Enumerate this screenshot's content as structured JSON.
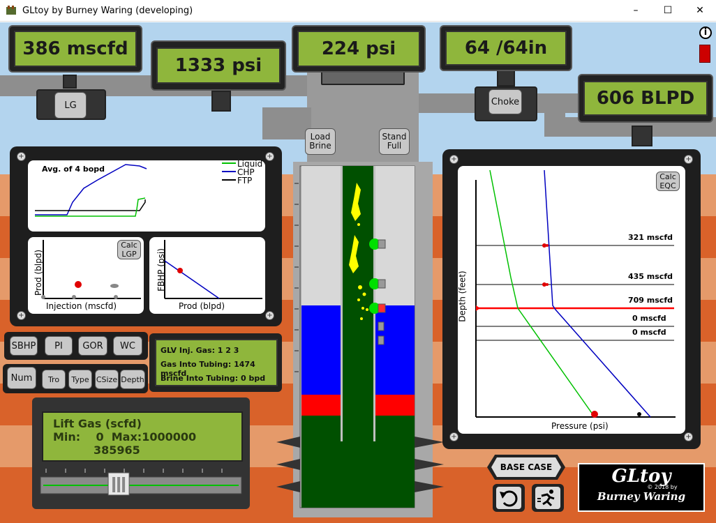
{
  "window": {
    "title": "GLtoy by Burney Waring (developing)",
    "min": "–",
    "max": "☐",
    "close": "✕"
  },
  "gauges": {
    "lift_gas": "386 mscfd",
    "casing_pressure": "1333 psi",
    "tubing_pressure": "224 psi",
    "choke": "64 /64in",
    "production": "606 BLPD"
  },
  "buttons": {
    "lg": "LG",
    "choke": "Choke",
    "load_brine": "Load\nBrine",
    "stand_full": "Stand\nFull",
    "calc_lgp": "Calc\nLGP",
    "calc_eqc": "Calc\nEQC",
    "sbhp": "SBHP",
    "pi": "PI",
    "gor": "GOR",
    "wc": "WC",
    "num": "Num",
    "tro": "Tro",
    "type": "Type",
    "csize": "CSize",
    "depth": "Depth",
    "base_case": "BASE CASE",
    "info": "i"
  },
  "trend": {
    "title": "Avg. of  4 bopd",
    "legend": [
      {
        "name": "Liquid",
        "color": "#00c000"
      },
      {
        "name": "CHP",
        "color": "#0000c0"
      },
      {
        "name": "FTP",
        "color": "#000000"
      }
    ]
  },
  "lgp_plot": {
    "ylabel": "Prod (blpd)",
    "xlabel": "Injection (mscfd)"
  },
  "ipr_plot": {
    "ylabel": "FBHP (psi)",
    "xlabel": "Prod (blpd)"
  },
  "glv_info": {
    "line1": "GLV Inj. Gas: 1 2 3",
    "line2": "Gas Into Tubing: 1474 mscfd",
    "line3": "Brine Into Tubing: 0 bpd"
  },
  "slider": {
    "title": "Lift Gas (scfd)",
    "range": "Min:    0  Max:1000000",
    "value": "385965",
    "fraction": 0.386
  },
  "depth_plot": {
    "ylabel": "Depth (feet)",
    "xlabel": "Pressure (psi)",
    "valve_labels": [
      "321 mscfd",
      "435 mscfd",
      "709 mscfd",
      "0 mscfd",
      "0 mscfd"
    ]
  },
  "logo": {
    "name": "GLtoy",
    "copyright": "© 2018 by",
    "author": "Burney Waring"
  },
  "colors": {
    "lcd": "#8fb63c",
    "liquid": "#00c000",
    "chp": "#0000c0",
    "brine": "#0000ff",
    "tubing": "#005000"
  }
}
